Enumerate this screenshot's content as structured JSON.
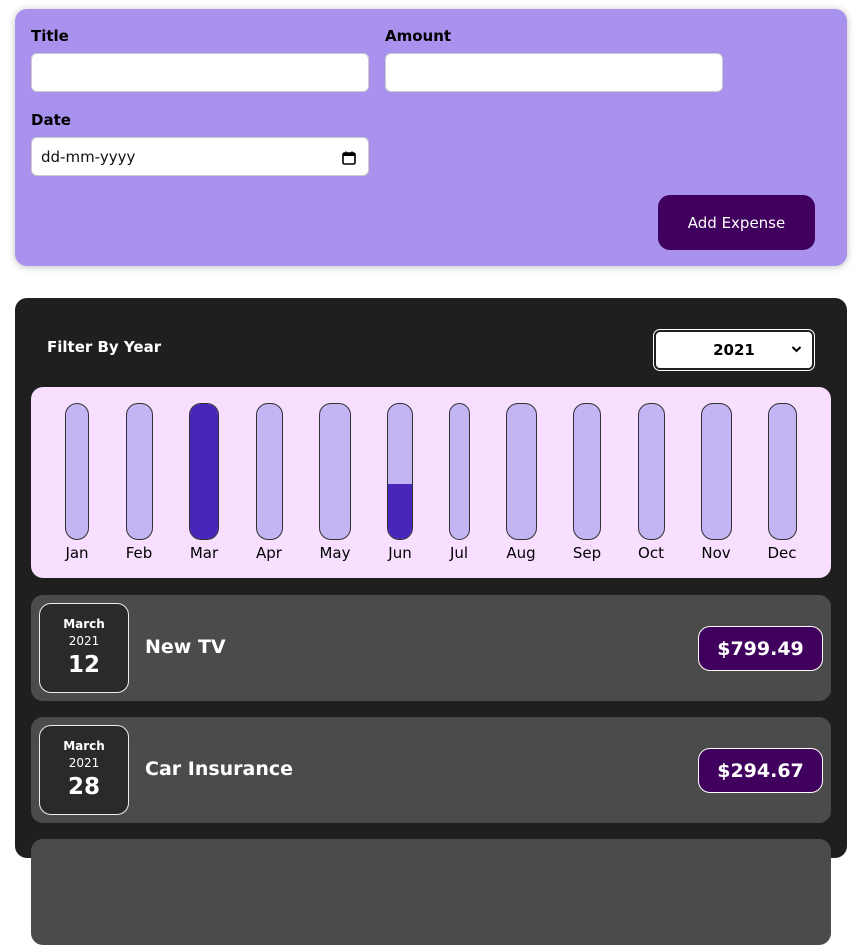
{
  "form": {
    "title_label": "Title",
    "title_value": "",
    "amount_label": "Amount",
    "amount_value": "",
    "date_label": "Date",
    "date_placeholder": "dd-mm-yyyy",
    "add_button": "Add Expense"
  },
  "filter": {
    "label": "Filter By Year",
    "selected_year": "2021"
  },
  "chart_data": {
    "type": "bar",
    "categories": [
      "Jan",
      "Feb",
      "Mar",
      "Apr",
      "May",
      "Jun",
      "Jul",
      "Aug",
      "Sep",
      "Oct",
      "Nov",
      "Dec"
    ],
    "values": [
      0,
      0,
      1.0,
      0,
      0,
      0.41,
      0,
      0,
      0,
      0,
      0,
      0
    ],
    "fill_color": "#4826b9",
    "track_color": "#c3b4f3"
  },
  "expenses": [
    {
      "month": "March",
      "year": "2021",
      "day": "12",
      "title": "New TV",
      "amount": "$799.49"
    },
    {
      "month": "March",
      "year": "2021",
      "day": "28",
      "title": "Car Insurance",
      "amount": "$294.67"
    }
  ],
  "colors": {
    "form_bg": "#a892ee",
    "button_bg": "#40005d",
    "card_bg": "#1f1f1f",
    "chart_bg": "#f8dfff",
    "item_bg": "#4b4b4b"
  }
}
